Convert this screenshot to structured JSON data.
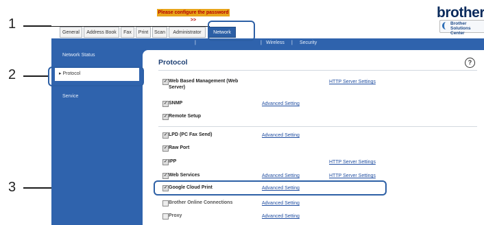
{
  "banner": "Please configure the password >>",
  "logo": "brother",
  "solutions_center": {
    "line1": "Brother",
    "line2": "Solutions Center"
  },
  "tabs": [
    "General",
    "Address Book",
    "Fax",
    "Print",
    "Scan",
    "Administrator",
    "Network"
  ],
  "subnav": [
    "|",
    "Wireless",
    "|",
    "Security"
  ],
  "sidebar": {
    "items": [
      "Network Status",
      "Protocol",
      "Service"
    ],
    "selected": "Protocol"
  },
  "page_title": "Protocol",
  "help_icon": "?",
  "protocols": [
    {
      "label": "Web Based Management (Web Server)",
      "checked": true,
      "link1": "",
      "link2": "HTTP Server Settings"
    },
    {
      "label": "SNMP",
      "checked": true,
      "link1": "Advanced Setting",
      "link2": ""
    },
    {
      "label": "Remote Setup",
      "checked": true,
      "link1": "",
      "link2": ""
    },
    {
      "label": "LPD (PC Fax Send)",
      "checked": true,
      "link1": "Advanced Setting",
      "link2": ""
    },
    {
      "label": "Raw Port",
      "checked": true,
      "link1": "",
      "link2": ""
    },
    {
      "label": "IPP",
      "checked": true,
      "link1": "",
      "link2": "HTTP Server Settings"
    },
    {
      "label": "Web Services",
      "checked": true,
      "link1": "Advanced Setting",
      "link2": "HTTP Server Settings"
    },
    {
      "label": "Google Cloud Print",
      "checked": true,
      "link1": "Advanced Setting",
      "link2": ""
    },
    {
      "label": "Brother Online Connections",
      "checked": false,
      "link1": "Advanced Setting",
      "link2": ""
    },
    {
      "label": "Proxy",
      "checked": false,
      "link1": "Advanced Setting",
      "link2": ""
    }
  ],
  "callouts": [
    "1",
    "2",
    "3"
  ]
}
